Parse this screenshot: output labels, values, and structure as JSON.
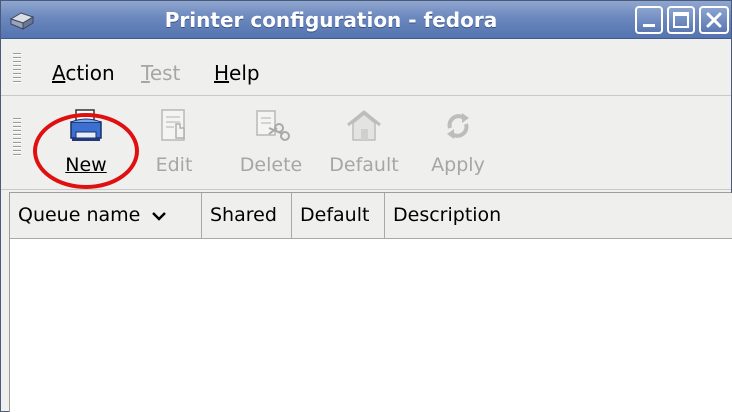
{
  "window": {
    "title": "Printer configuration - fedora",
    "controls": [
      "minimize",
      "maximize",
      "close"
    ]
  },
  "menubar": {
    "items": [
      {
        "label": "Action",
        "mnemonic": "A",
        "rest": "ction",
        "enabled": true
      },
      {
        "label": "Test",
        "mnemonic": "T",
        "rest": "est",
        "enabled": false
      },
      {
        "label": "Help",
        "mnemonic": "H",
        "rest": "elp",
        "enabled": true
      }
    ]
  },
  "toolbar": {
    "new_label": "New",
    "edit_label": "Edit",
    "delete_label": "Delete",
    "default_label": "Default",
    "apply_label": "Apply",
    "icons": {
      "new": "printer-icon",
      "edit": "edit-document-icon",
      "delete": "scissors-delete-icon",
      "default": "home-icon",
      "apply": "refresh-apply-icon"
    },
    "enabled": {
      "new": true,
      "edit": false,
      "delete": false,
      "default": false,
      "apply": false
    }
  },
  "annotation": {
    "color": "#e01010",
    "target": "New"
  },
  "table": {
    "columns": [
      "Queue name",
      "Shared",
      "Default",
      "Description"
    ],
    "sort_column": "Queue name",
    "sort_direction": "descending",
    "rows": []
  },
  "colors": {
    "titlebar": "#6b87bd",
    "window_bg": "#efefed",
    "disabled_text": "#a6a6a2"
  }
}
